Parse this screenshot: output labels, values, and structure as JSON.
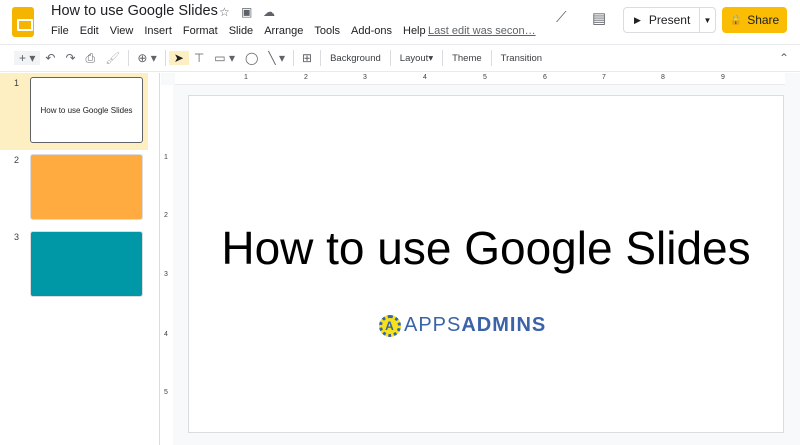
{
  "header": {
    "title": "How to use Google Slides",
    "last_edit": "Last edit was secon…",
    "present_label": "Present",
    "share_label": "Share"
  },
  "menu": [
    "File",
    "Edit",
    "View",
    "Insert",
    "Format",
    "Slide",
    "Arrange",
    "Tools",
    "Add-ons",
    "Help"
  ],
  "toolbar": {
    "background": "Background",
    "layout": "Layout",
    "theme": "Theme",
    "transition": "Transition"
  },
  "slides": [
    {
      "number": "1",
      "text": "How to use Google Slides",
      "color": "#ffffff"
    },
    {
      "number": "2",
      "text": "",
      "color": "#ffab40"
    },
    {
      "number": "3",
      "text": "",
      "color": "#0097a7"
    }
  ],
  "ruler": {
    "h": [
      "1",
      "2",
      "3",
      "4",
      "5",
      "6",
      "7",
      "8",
      "9"
    ],
    "v": [
      "1",
      "2",
      "3",
      "4",
      "5"
    ]
  },
  "slide": {
    "title": "How to use Google Slides",
    "brand_a": "A",
    "brand_light": "APPS",
    "brand_bold": "ADMINS"
  },
  "colors": {
    "share": "#fbbc04",
    "brand": "#3a63a8"
  }
}
